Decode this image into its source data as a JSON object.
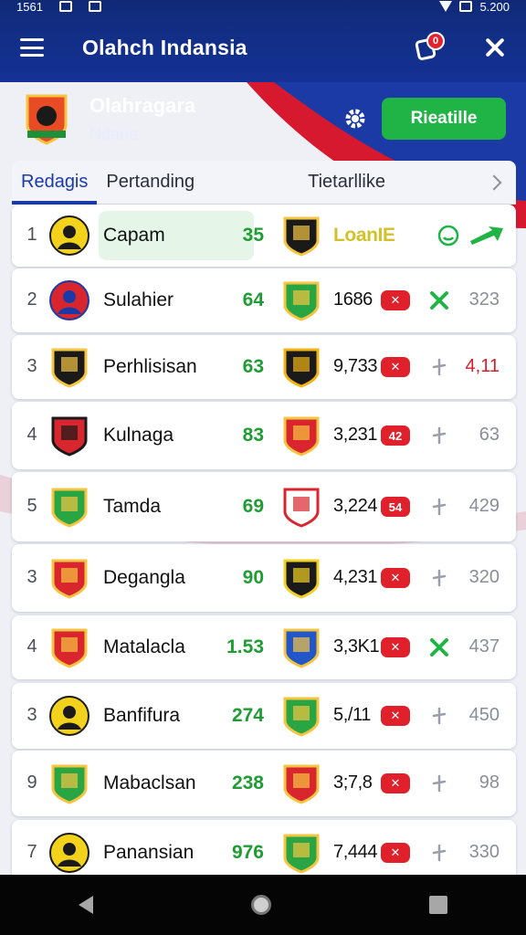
{
  "status_bar": {
    "time": "1561",
    "battery": "5.200"
  },
  "app_bar": {
    "title": "Olahch Indansia",
    "notification_count": "0"
  },
  "profile": {
    "name": "Olahragara",
    "subtitle": "Ndaria",
    "cta_label": "Rieatille"
  },
  "tabs": [
    {
      "label": "Redagis",
      "active": true
    },
    {
      "label": "Pertanding",
      "active": false
    },
    {
      "label": "Tietarllike",
      "active": false
    }
  ],
  "colors": {
    "brand_blue": "#143296",
    "accent_green": "#1fb445",
    "badge_red": "#e0212b",
    "points_green": "#1f9d34"
  },
  "rows": [
    {
      "rank": "1",
      "name": "Capam",
      "points": "35",
      "crest_icon": "player-avatar-icon",
      "opp_crest_icon": "shield-crest-icon",
      "value": "LoanIE",
      "badge": "",
      "stat_icon": "smile-icon",
      "last": "",
      "highlight": true
    },
    {
      "rank": "2",
      "name": "Sulahier",
      "points": "64",
      "crest_icon": "striped-ball-icon",
      "opp_crest_icon": "green-shield-icon",
      "value": "1686",
      "badge": "✕",
      "stat_icon": "cross-icon",
      "last": "323",
      "highlight": false
    },
    {
      "rank": "3",
      "name": "Perhlisisan",
      "points": "63",
      "crest_icon": "black-shield-icon",
      "opp_crest_icon": "gold-shield-icon",
      "value": "9,733",
      "badge": "✕",
      "stat_icon": "plus-icon",
      "last": "4,11",
      "last_red": true,
      "highlight": false
    },
    {
      "rank": "4",
      "name": "Kulnaga",
      "points": "83",
      "crest_icon": "striped-shield-icon",
      "opp_crest_icon": "red-shield-icon",
      "value": "3,231",
      "badge": "42",
      "stat_icon": "plus-icon",
      "last": "63",
      "highlight": false
    },
    {
      "rank": "5",
      "name": "Tamda",
      "points": "69",
      "crest_icon": "green-shield-icon",
      "opp_crest_icon": "red-cross-shield-icon",
      "value": "3,224",
      "badge": "54",
      "stat_icon": "plus-icon",
      "last": "429",
      "highlight": false
    },
    {
      "rank": "3",
      "name": "Degangla",
      "points": "90",
      "crest_icon": "red-striped-shield-icon",
      "opp_crest_icon": "black-gold-shield-icon",
      "value": "4,231",
      "badge": "✕",
      "stat_icon": "plus-icon",
      "last": "320",
      "highlight": false
    },
    {
      "rank": "4",
      "name": "Matalacla",
      "points": "1.53",
      "crest_icon": "red-striped-shield-icon",
      "opp_crest_icon": "blue-shield-icon",
      "value": "3,3K1",
      "badge": "✕",
      "stat_icon": "cross-icon",
      "last": "437",
      "highlight": false
    },
    {
      "rank": "3",
      "name": "Banfifura",
      "points": "274",
      "crest_icon": "player-avatar-icon",
      "opp_crest_icon": "green-shield-icon",
      "value": "5,/11",
      "badge": "✕",
      "stat_icon": "plus-icon",
      "last": "450",
      "highlight": false
    },
    {
      "rank": "9",
      "name": "Mabaclsan",
      "points": "238",
      "crest_icon": "green-shield-icon",
      "opp_crest_icon": "red-shield-icon",
      "value": "3;7,8",
      "badge": "✕",
      "stat_icon": "plus-icon",
      "last": "98",
      "highlight": false
    },
    {
      "rank": "7",
      "name": "Panansian",
      "points": "976",
      "crest_icon": "player-avatar-icon",
      "opp_crest_icon": "green-shield-icon",
      "value": "7,444",
      "badge": "✕",
      "stat_icon": "plus-icon",
      "last": "330",
      "highlight": false
    }
  ]
}
